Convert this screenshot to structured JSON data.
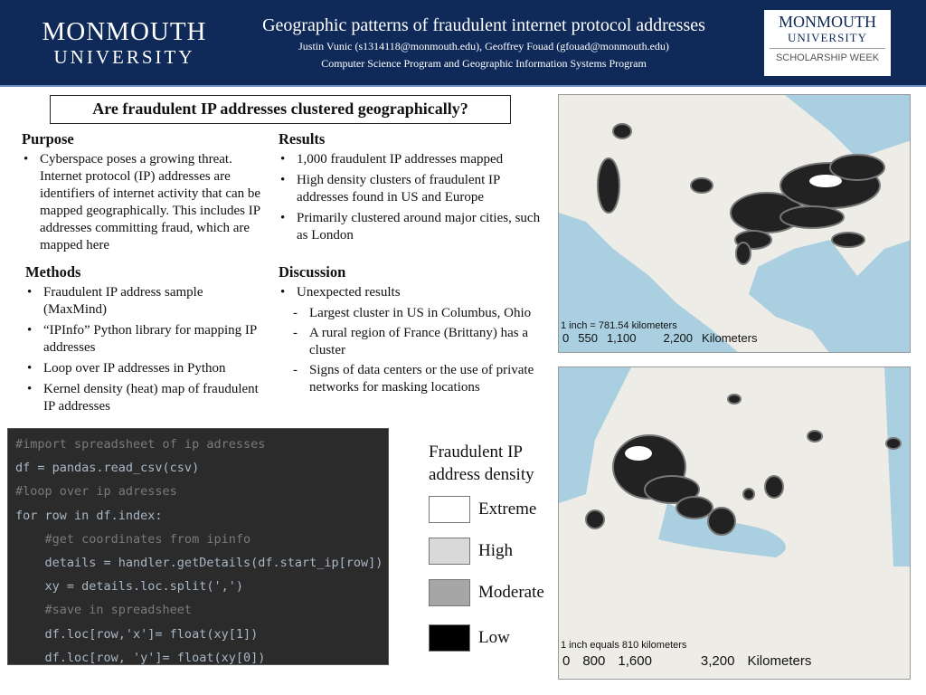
{
  "header": {
    "logo_left_line1": "MONMOUTH",
    "logo_left_line2": "UNIVERSITY",
    "title": "Geographic patterns of fraudulent internet protocol addresses",
    "authors": "Justin Vunic (s1314118@monmouth.edu), Geoffrey Fouad (gfouad@monmouth.edu)",
    "program": "Computer Science Program and Geographic Information Systems Program",
    "logo_right_line1": "MONMOUTH",
    "logo_right_line2": "UNIVERSITY",
    "logo_right_line3": "SCHOLARSHIP WEEK"
  },
  "question": "Are fraudulent IP addresses clustered geographically?",
  "purpose": {
    "heading": "Purpose",
    "items": [
      "Cyberspace poses a growing threat. Internet protocol (IP) addresses are identifiers of internet activity that can be mapped geographically. This includes IP addresses committing fraud, which are mapped here"
    ]
  },
  "methods": {
    "heading": "Methods",
    "items": [
      "Fraudulent IP address sample (MaxMind)",
      "“IPInfo” Python library for mapping IP addresses",
      "Loop over IP addresses in Python",
      "Kernel density (heat) map of fraudulent IP addresses"
    ]
  },
  "results": {
    "heading": "Results",
    "items": [
      "1,000 fraudulent IP addresses mapped",
      "High density clusters of fraudulent IP addresses found in US and Europe",
      "Primarily clustered around major cities, such as London"
    ]
  },
  "discussion": {
    "heading": "Discussion",
    "item": "Unexpected results",
    "subitems": [
      "Largest cluster in US in Columbus, Ohio",
      "A rural region of France (Brittany) has a cluster",
      "Signs of data centers or the use of private networks for masking locations"
    ]
  },
  "code": {
    "lines": [
      "#import spreadsheet of ip adresses",
      "df = pandas.read_csv(csv)",
      "#loop over ip adresses",
      "for row in df.index:",
      "    #get coordinates from ipinfo",
      "    details = handler.getDetails(df.start_ip[row])",
      "    xy = details.loc.split(',')",
      "    #save in spreadsheet",
      "    df.loc[row,'x']= float(xy[1])",
      "    df.loc[row, 'y']= float(xy[0])"
    ]
  },
  "legend": {
    "title": "Fraudulent IP address density",
    "items": [
      {
        "label": "Extreme",
        "color": "#ffffff"
      },
      {
        "label": "High",
        "color": "#d9d9d9"
      },
      {
        "label": "Moderate",
        "color": "#a6a6a6"
      },
      {
        "label": "Low",
        "color": "#000000"
      }
    ]
  },
  "map_na": {
    "scale_text": "1 inch = 781.54 kilometers",
    "ticks": [
      "0",
      "550",
      "1,100",
      "2,200"
    ],
    "unit": "Kilometers"
  },
  "map_eu": {
    "scale_text": "1 inch equals 810 kilometers",
    "ticks": [
      "0",
      "800",
      "1,600",
      "3,200"
    ],
    "unit": "Kilometers"
  }
}
